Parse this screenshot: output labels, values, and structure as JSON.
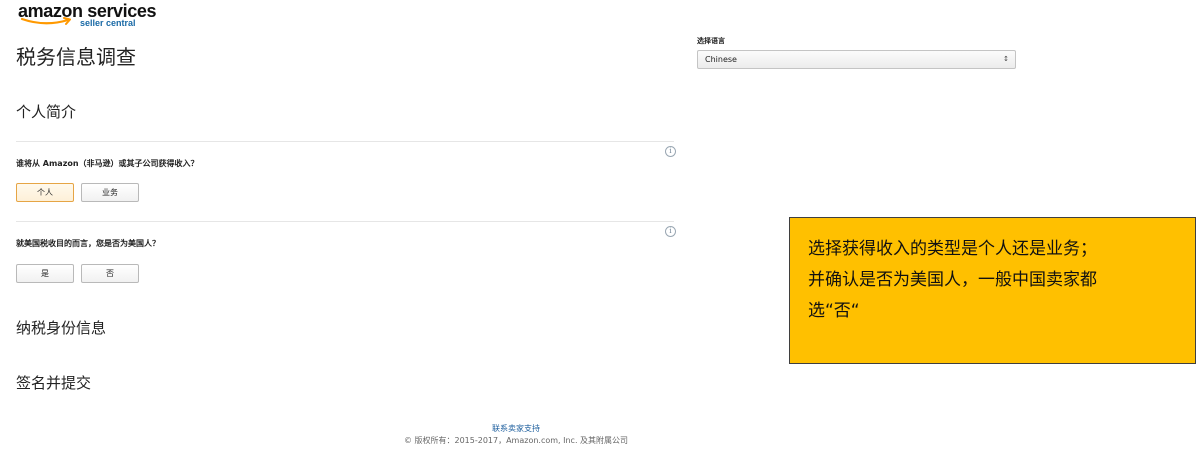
{
  "brand": {
    "name": "amazon services",
    "sub": "seller central",
    "logo_color": "#111111",
    "sub_color": "#1a6aa6",
    "smile_color": "#ff9900"
  },
  "page": {
    "title": "税务信息调查"
  },
  "language": {
    "label": "选择语言",
    "selected": "Chinese",
    "arrow_icon": "chevron-updown-icon"
  },
  "sections": {
    "profile": {
      "heading": "个人简介",
      "q1": {
        "text": "谁将从 Amazon（非马逊）或其子公司获得收入？",
        "options": [
          "个人",
          "业务"
        ],
        "selected": "个人"
      },
      "q2": {
        "text": "就美国税收目的而言，您是否为美国人？",
        "options": [
          "是",
          "否"
        ]
      }
    },
    "tax_identity": {
      "heading": "纳税身份信息"
    },
    "sign": {
      "heading": "签名并提交"
    }
  },
  "info_icon": {
    "glyph": "i",
    "name": "info-icon"
  },
  "callout": {
    "lines": [
      "选择获得收入的类型是个人还是业务；",
      "并确认是否为美国人，一般中国卖家都",
      "选“否“"
    ],
    "background": "#ffc000"
  },
  "footer": {
    "link": "联系卖家支持",
    "copyright": "© 版权所有：2015-2017，Amazon.com, Inc. 及其附属公司"
  },
  "colors": {
    "selected_border": "#e6a545",
    "link": "#1e5f9e"
  }
}
